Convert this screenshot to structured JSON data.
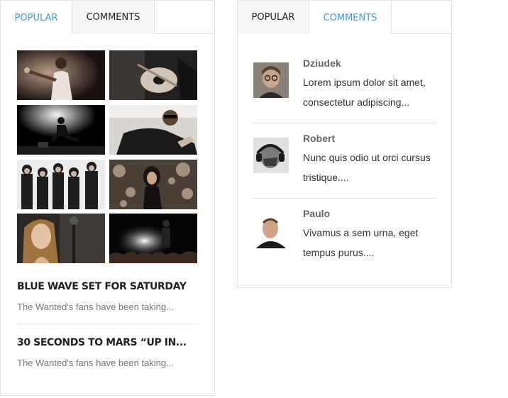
{
  "left_widget": {
    "tabs": [
      {
        "label": "POPULAR",
        "active": true
      },
      {
        "label": "COMMENTS",
        "active": false
      }
    ],
    "gallery": [
      "guitarist-photo",
      "acoustic-guitar-photo",
      "jumping-performer-photo",
      "sunglasses-man-photo",
      "band-group-photo",
      "woman-bokeh-photo",
      "singer-microphone-photo",
      "concert-crowd-photo"
    ],
    "posts": [
      {
        "title": "BLUE WAVE SET FOR SATURDAY",
        "excerpt": "The Wanted's fans have been taking..."
      },
      {
        "title": "30 SECONDS TO MARS “UP IN...",
        "excerpt": "The Wanted's fans have been taking..."
      }
    ]
  },
  "right_widget": {
    "tabs": [
      {
        "label": "POPULAR",
        "active": false
      },
      {
        "label": "COMMENTS",
        "active": true
      }
    ],
    "comments": [
      {
        "author": "Dziudek",
        "text": "Lorem ipsum dolor sit amet, consectetur adipiscing..."
      },
      {
        "author": "Robert",
        "text": "Nunc quis odio ut orci cursus tristique...."
      },
      {
        "author": "Paulo",
        "text": "Vivamus a sem urna, eget tempus purus...."
      }
    ]
  },
  "colors": {
    "accent": "#3f9fd6",
    "border": "#e5e5e5",
    "inactive_tab_bg": "#f7f7f7",
    "title": "#222222",
    "muted": "#777777"
  }
}
